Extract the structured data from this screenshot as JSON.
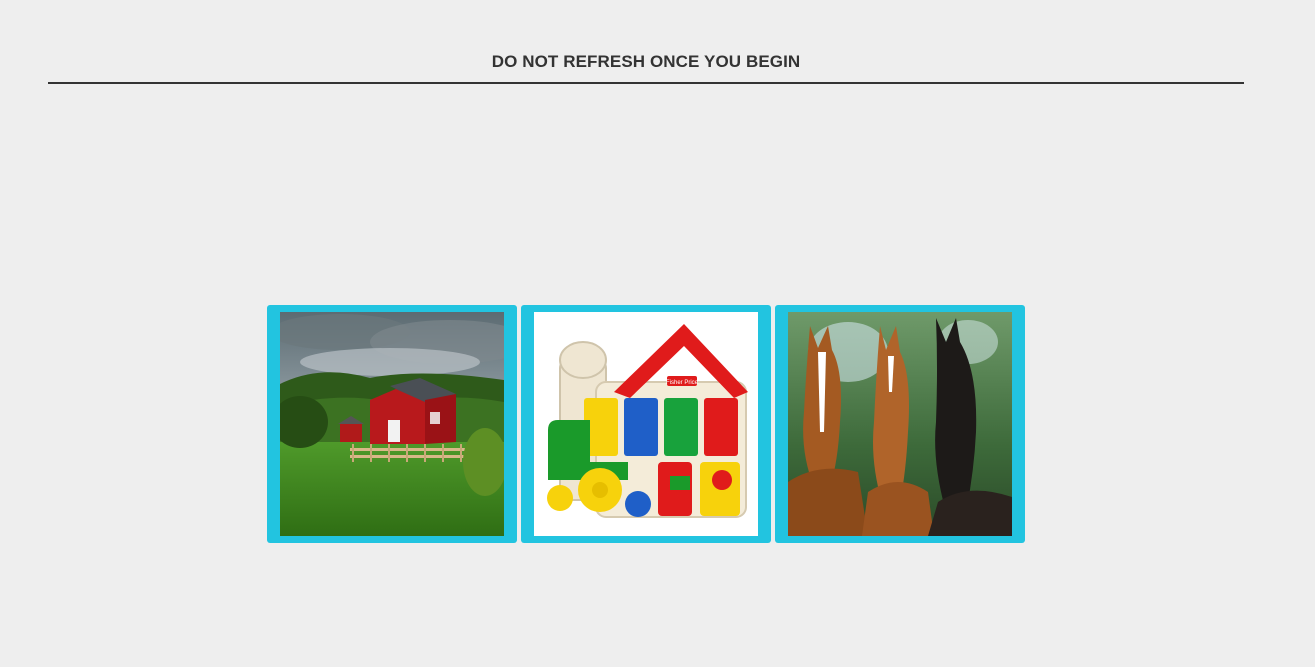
{
  "header": {
    "title": "DO NOT REFRESH ONCE YOU BEGIN"
  },
  "choices": [
    {
      "icon": "barn-photo"
    },
    {
      "icon": "toy-barn-photo",
      "brand_text": "Fisher Price"
    },
    {
      "icon": "horses-photo"
    }
  ],
  "colors": {
    "background": "#eeeeee",
    "card_border": "#22c4e0",
    "title_text": "#333333"
  }
}
